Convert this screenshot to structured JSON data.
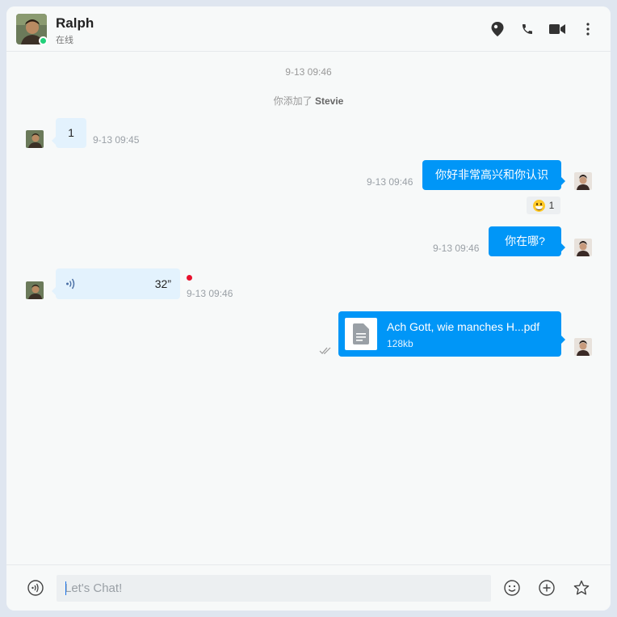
{
  "header": {
    "name": "Ralph",
    "status": "在线",
    "icons": [
      "location-icon",
      "phone-icon",
      "video-icon",
      "more-icon"
    ]
  },
  "messages": {
    "date_label": "9-13 09:46",
    "system_prefix": "你添加了",
    "system_name": "Stevie",
    "m1": {
      "text": "1",
      "time": "9-13 09:45"
    },
    "m2": {
      "text": "你好非常高兴和你认识",
      "time": "9-13 09:46",
      "reaction_count": "1"
    },
    "m3": {
      "text": "你在哪?",
      "time": "9-13 09:46"
    },
    "m4": {
      "duration": "32”",
      "time": "9-13 09:46"
    },
    "m5": {
      "file_name": "Ach Gott, wie manches H...pdf",
      "file_size": "128kb"
    }
  },
  "input": {
    "placeholder": "Let's Chat!"
  },
  "colors": {
    "accent": "#0096f7",
    "incoming": "#e3f2fd",
    "online": "#22d07a",
    "unread": "#e8112d"
  }
}
